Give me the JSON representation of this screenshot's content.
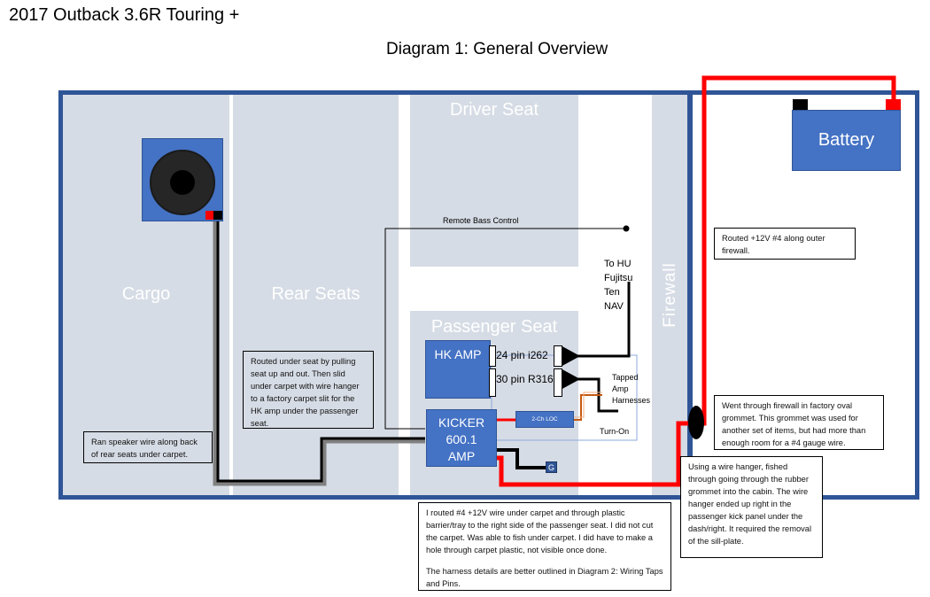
{
  "header": {
    "vehicle_title": "2017 Outback 3.6R Touring +",
    "diagram_title": "Diagram 1: General Overview"
  },
  "zones": {
    "cargo": "Cargo",
    "rear_seats": "Rear Seats",
    "driver_seat": "Driver Seat",
    "passenger_seat": "Passenger Seat",
    "firewall": "Firewall"
  },
  "components": {
    "battery": "Battery",
    "hk_amp": "HK AMP",
    "kicker_amp_line1": "KICKER",
    "kicker_amp_line2": "600.1",
    "kicker_amp_line3": "AMP",
    "loc": "2-Ch LOC",
    "ground": "G",
    "connector_24": "24 pin i262",
    "connector_30": "30 pin R316"
  },
  "labels": {
    "remote_bass": "Remote Bass Control",
    "to_hu": [
      "To HU",
      "Fujitsu",
      "Ten",
      "NAV"
    ],
    "tapped": [
      "Tapped",
      "Amp",
      "Harnesses"
    ],
    "turn_on": "Turn-On"
  },
  "notes": {
    "speaker_wire": "Ran speaker wire along back of rear seats under carpet.",
    "under_seat": "Routed under seat by pulling seat up and out. Then slid under carpet with wire hanger to a factory carpet slit for the HK amp under the passenger seat.",
    "outer_firewall": "Routed +12V #4 along outer firewall.",
    "grommet": "Went through firewall in factory oval grommet. This grommet was used for another set of items, but had more than enough room for a #4 gauge wire.",
    "wire_hanger": "Using a wire hanger, fished through going through the rubber grommet into the cabin. The wire hanger ended up right in the passenger kick panel under the dash/right. It required the removal of the sill-plate.",
    "routed_p1": "I routed #4 +12V wire under carpet and through plastic barrier/tray to the right side of the passenger seat. I did not cut the carpet. Was able to fish under carpet. I did have to make a hole through carpet plastic, not visible once done.",
    "routed_p2": "The harness details are better outlined in Diagram 2: Wiring Taps and Pins."
  },
  "colors": {
    "frame": "#2f5597",
    "zone": "#d6dce5",
    "component": "#4472c4",
    "power_wire": "#ff0000",
    "ground_wire": "#000000"
  }
}
